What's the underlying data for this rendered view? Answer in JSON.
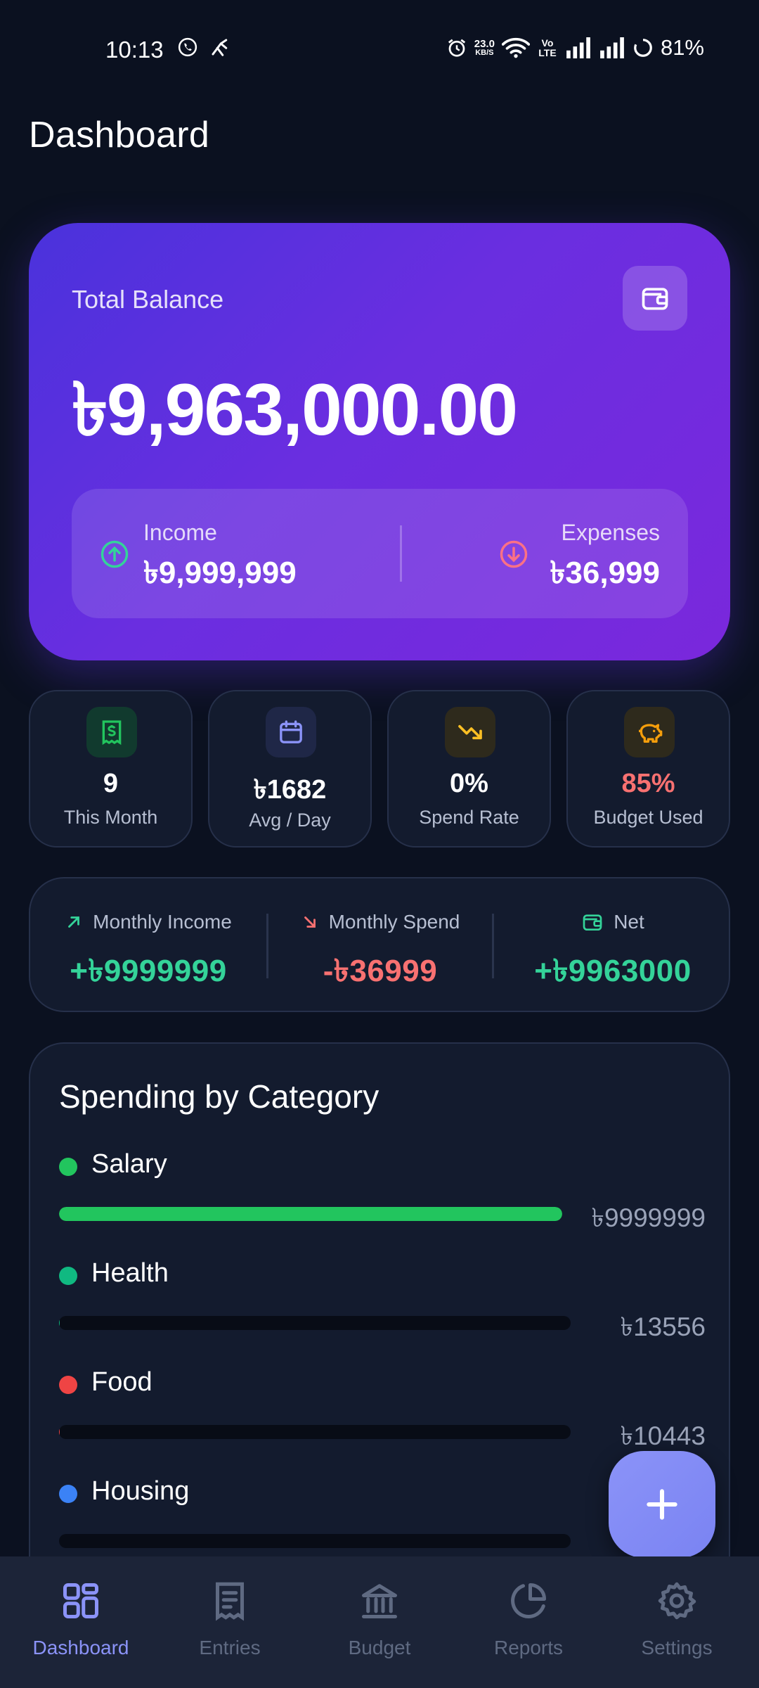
{
  "status_bar": {
    "time": "10:13",
    "speed_value": "23.0",
    "speed_unit": "KB/S",
    "volte": "Vo LTE",
    "battery": "81%",
    "icons": [
      "whatsapp-icon",
      "call-icon",
      "alarm-icon",
      "wifi-icon",
      "signal-icon",
      "signal-icon",
      "battery-icon"
    ]
  },
  "header": {
    "title": "Dashboard"
  },
  "balance_card": {
    "label": "Total Balance",
    "amount": "৳9,963,000.00",
    "income_label": "Income",
    "income_value": "৳9,999,999",
    "expenses_label": "Expenses",
    "expenses_value": "৳36,999",
    "icon": "wallet-icon"
  },
  "stats": [
    {
      "icon": "receipt-icon",
      "value": "9",
      "label": "This Month",
      "accent": "#22c55e"
    },
    {
      "icon": "calendar-icon",
      "value": "৳1682",
      "label": "Avg / Day",
      "accent": "#8b93f8"
    },
    {
      "icon": "trending-down-icon",
      "value": "0%",
      "label": "Spend Rate",
      "accent": "#fbbf24"
    },
    {
      "icon": "piggy-bank-icon",
      "value": "85%",
      "label": "Budget Used",
      "accent": "#f59e0b"
    }
  ],
  "summary": {
    "income_label": "Monthly Income",
    "income_value": "+৳9999999",
    "spend_label": "Monthly Spend",
    "spend_value": "-৳36999",
    "net_label": "Net",
    "net_value": "+৳9963000"
  },
  "categories": {
    "title": "Spending by Category",
    "items": [
      {
        "name": "Salary",
        "amount": "৳9999999",
        "color": "#22c55e",
        "fraction": 1.0
      },
      {
        "name": "Health",
        "amount": "৳13556",
        "color": "#10b981",
        "fraction": 0.0014
      },
      {
        "name": "Food",
        "amount": "৳10443",
        "color": "#ef4444",
        "fraction": 0.001
      },
      {
        "name": "Housing",
        "amount": "",
        "color": "#3b82f6",
        "fraction": 0.0
      }
    ]
  },
  "fab": {
    "icon": "plus-icon"
  },
  "nav": {
    "items": [
      {
        "label": "Dashboard",
        "icon": "dashboard-grid-icon",
        "active": true
      },
      {
        "label": "Entries",
        "icon": "receipt-list-icon",
        "active": false
      },
      {
        "label": "Budget",
        "icon": "bank-icon",
        "active": false
      },
      {
        "label": "Reports",
        "icon": "pie-chart-icon",
        "active": false
      },
      {
        "label": "Settings",
        "icon": "gear-icon",
        "active": false
      }
    ]
  },
  "colors": {
    "background": "#0b1120",
    "card": "#131b2e",
    "accent": "#8b93f8",
    "positive": "#34d399",
    "negative": "#f87171",
    "budget_used": "#f87171"
  }
}
